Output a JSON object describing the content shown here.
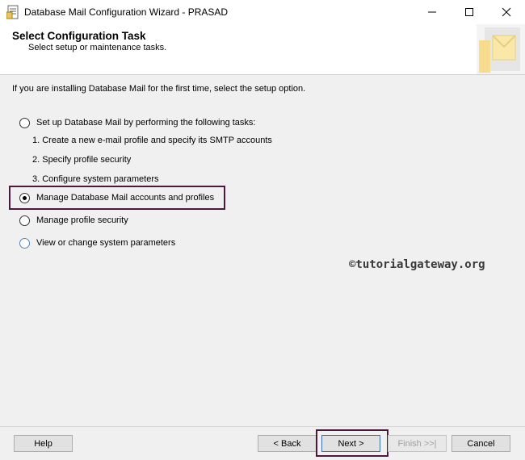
{
  "window": {
    "title": "Database Mail Configuration Wizard - PRASAD",
    "controls": [
      "minimize-icon",
      "maximize-icon",
      "close-icon"
    ]
  },
  "header": {
    "title": "Select Configuration Task",
    "subtitle": "Select setup or maintenance tasks."
  },
  "body": {
    "intro": "If you are installing Database Mail for the first time, select the setup option.",
    "options": [
      {
        "label": "Set up Database Mail by performing the following tasks:",
        "selected": false
      },
      {
        "label": "Manage Database Mail accounts and profiles",
        "selected": true
      },
      {
        "label": "Manage profile security",
        "selected": false
      },
      {
        "label": "View or change system parameters",
        "selected": false
      }
    ],
    "setup_steps": [
      "1. Create a new e-mail profile and specify its SMTP accounts",
      "2. Specify profile security",
      "3. Configure system parameters"
    ],
    "watermark": "©tutorialgateway.org"
  },
  "buttons": {
    "help": "Help",
    "back": "< Back",
    "next": "Next >",
    "finish": "Finish >>|",
    "cancel": "Cancel"
  },
  "colors": {
    "highlight_border": "#4a1a3c",
    "radio_blue": "#4d86c8"
  }
}
